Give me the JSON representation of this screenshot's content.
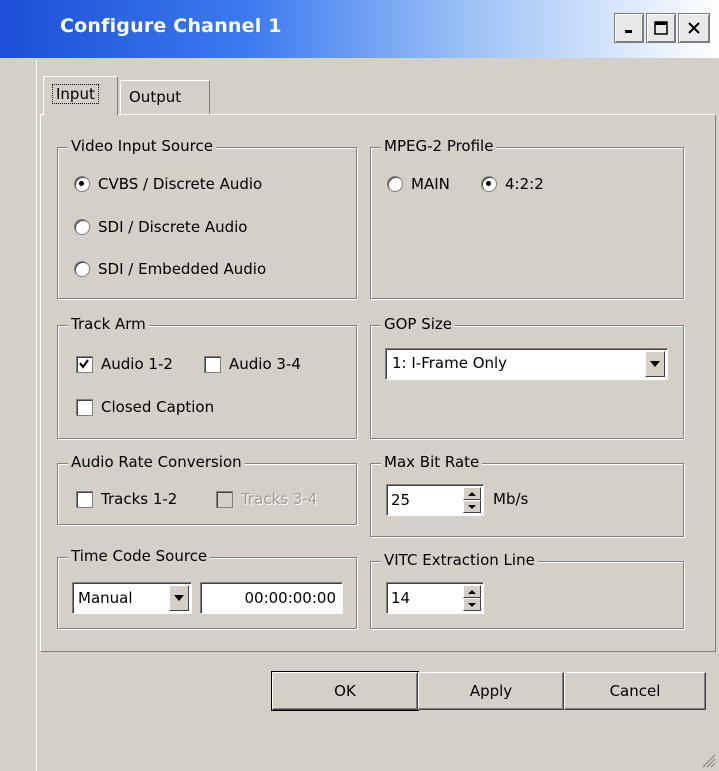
{
  "window": {
    "title": "Configure Channel 1",
    "controls": [
      "minimize-icon",
      "maximize-icon",
      "close-icon"
    ],
    "title_gradient": [
      "#1c4fd6",
      "#ffffff"
    ]
  },
  "tabs": [
    {
      "label": "Input",
      "selected": true
    },
    {
      "label": "Output",
      "selected": false
    }
  ],
  "video_input_source": {
    "label": "Video Input Source",
    "options": [
      {
        "label": "CVBS / Discrete Audio",
        "selected": true
      },
      {
        "label": "SDI / Discrete Audio",
        "selected": false
      },
      {
        "label": "SDI / Embedded Audio",
        "selected": false
      }
    ]
  },
  "mpeg2_profile": {
    "label": "MPEG-2 Profile",
    "options": [
      {
        "label": "MAIN",
        "selected": false
      },
      {
        "label": "4:2:2",
        "selected": true
      }
    ]
  },
  "track_arm": {
    "label": "Track Arm",
    "options": [
      {
        "label": "Audio 1-2",
        "checked": true
      },
      {
        "label": "Audio 3-4",
        "checked": false
      },
      {
        "label": "Closed Caption",
        "checked": false
      }
    ]
  },
  "gop_size": {
    "label": "GOP Size",
    "value": "1: I-Frame Only"
  },
  "audio_rate_conversion": {
    "label": "Audio Rate Conversion",
    "options": [
      {
        "label": "Tracks 1-2",
        "checked": false,
        "enabled": true
      },
      {
        "label": "Tracks 3-4",
        "checked": false,
        "enabled": false
      }
    ]
  },
  "max_bit_rate": {
    "label": "Max Bit Rate",
    "value": "25",
    "unit": "Mb/s"
  },
  "time_code_source": {
    "label": "Time Code Source",
    "mode": "Manual",
    "value": "00:00:00:00"
  },
  "vitc_extraction_line": {
    "label": "VITC Extraction Line",
    "value": "14"
  },
  "buttons": {
    "ok": "OK",
    "apply": "Apply",
    "cancel": "Cancel"
  }
}
